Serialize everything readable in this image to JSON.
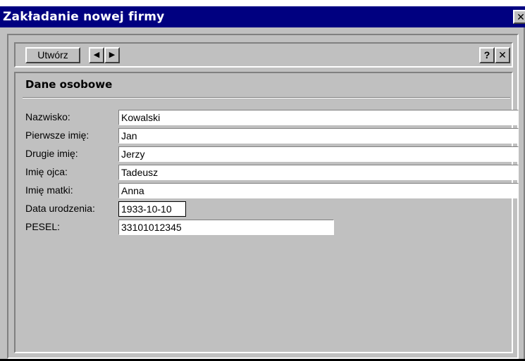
{
  "window": {
    "title": "Zakładanie nowej firmy",
    "close_glyph": "✕"
  },
  "toolbar": {
    "create_label": "Utwórz",
    "prev_glyph": "◀",
    "next_glyph": "▶",
    "help_label": "?",
    "close_label": "✕"
  },
  "section": {
    "title": "Dane osobowe"
  },
  "fields": {
    "surname": {
      "label": "Nazwisko:",
      "value": "Kowalski"
    },
    "first_name": {
      "label": "Pierwsze imię:",
      "value": "Jan"
    },
    "second_name": {
      "label": "Drugie imię:",
      "value": "Jerzy"
    },
    "father_name": {
      "label": "Imię ojca:",
      "value": "Tadeusz"
    },
    "mother_name": {
      "label": "Imię matki:",
      "value": "Anna"
    },
    "birth_date": {
      "label": "Data urodzenia:",
      "value": "1933-10-10"
    },
    "pesel": {
      "label": "PESEL:",
      "value": "33101012345"
    }
  },
  "colors": {
    "titlebar": "#000080",
    "face": "#c0c0c0",
    "field": "#ffffff"
  }
}
